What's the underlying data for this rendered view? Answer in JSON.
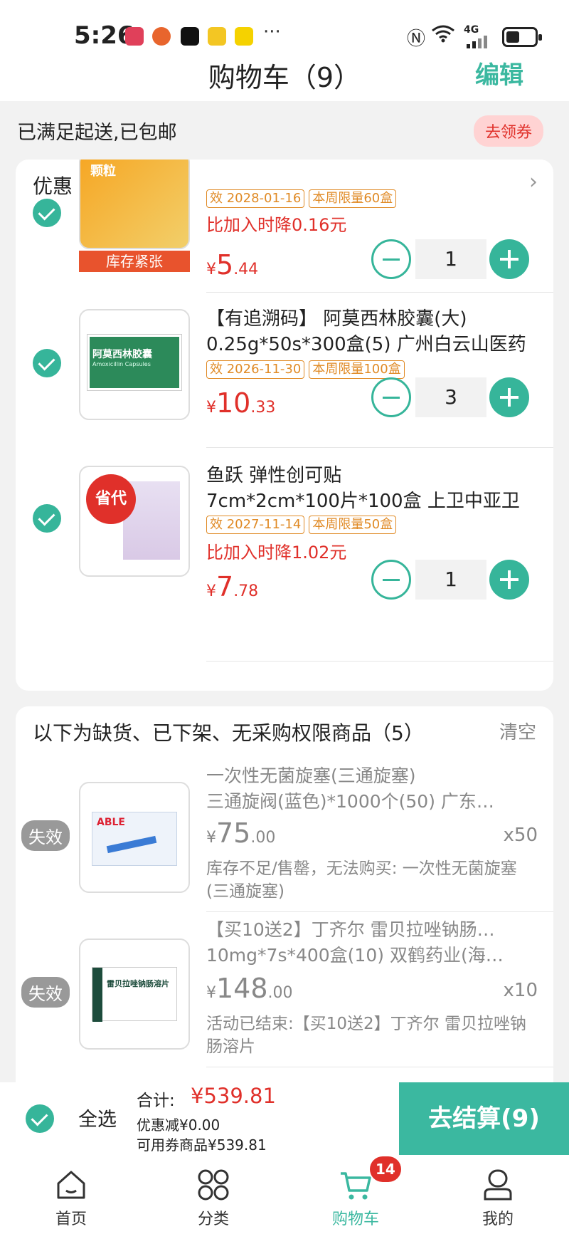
{
  "status_bar": {
    "time": "5:26",
    "network": "4G",
    "more": "···"
  },
  "header": {
    "title": "购物车（9）",
    "edit_label": "编辑"
  },
  "notice": {
    "text": "已满足起送,已包邮",
    "coupon_label": "去领券"
  },
  "promo_section": {
    "title": "优惠",
    "items": [
      {
        "expiry": "效 2028-01-16",
        "limit": "本周限量60盒",
        "price_drop": "比加入时降0.16元",
        "price_int": "5",
        "price_dec": ".44",
        "currency": "¥",
        "quantity": "1",
        "stock_badge": "库存紧张",
        "thumb_text": "颗粒"
      },
      {
        "name_line1": "【有追溯码】 阿莫西林胶囊(大)",
        "name_line2": "0.25g*50s*300盒(5) 广州白云山医药",
        "expiry": "效 2026-11-30",
        "limit": "本周限量100盒",
        "price_int": "10",
        "price_dec": ".33",
        "currency": "¥",
        "quantity": "3",
        "thumb_text": "阿莫西林胶囊",
        "thumb_sub": "Amoxicillin Capsules"
      },
      {
        "name_line1": "鱼跃 弹性创可贴",
        "name_line2": "7cm*2cm*100片*100盒 上卫中亚卫",
        "expiry": "效 2027-11-14",
        "limit": "本周限量50盒",
        "price_drop": "比加入时降1.02元",
        "price_int": "7",
        "price_dec": ".78",
        "currency": "¥",
        "quantity": "1",
        "thumb_badge": "省代"
      }
    ]
  },
  "invalid_section": {
    "title": "以下为缺货、已下架、无采购权限商品（5）",
    "clear_label": "清空",
    "items": [
      {
        "badge": "失效",
        "name_line1": " 一次性无菌旋塞(三通旋塞)",
        "name_line2": "三通旋阀(蓝色)*1000个(50) 广东…",
        "currency": "¥",
        "price_int": "75",
        "price_dec": ".00",
        "qty": "x50",
        "reason": "库存不足/售罄，无法购买: 一次性无菌旋塞(三通旋塞)",
        "thumb_text": "ABLE"
      },
      {
        "badge": "失效",
        "name_line1": "【买10送2】丁齐尔 雷贝拉唑钠肠…",
        "name_line2": "10mg*7s*400盒(10) 双鹤药业(海…",
        "currency": "¥",
        "price_int": "148",
        "price_dec": ".00",
        "qty": "x10",
        "reason": "活动已结束:【买10送2】丁齐尔 雷贝拉唑钠肠溶片",
        "thumb_text": "雷贝拉唑钠肠溶片"
      }
    ]
  },
  "bottom_bar": {
    "select_all": "全选",
    "total_label": "合计:",
    "total_value": "¥539.81",
    "discount": "优惠减¥0.00",
    "coupon_eligible": "可用券商品¥539.81",
    "checkout": "去结算(9)"
  },
  "tabbar": {
    "tabs": [
      {
        "label": "首页",
        "icon": "home-icon"
      },
      {
        "label": "分类",
        "icon": "category-icon"
      },
      {
        "label": "购物车",
        "icon": "cart-icon"
      },
      {
        "label": "我的",
        "icon": "profile-icon"
      }
    ],
    "cart_badge": "14"
  },
  "colors": {
    "accent": "#3bb8a0",
    "price": "#e0302a",
    "tag": "#e08a25"
  }
}
